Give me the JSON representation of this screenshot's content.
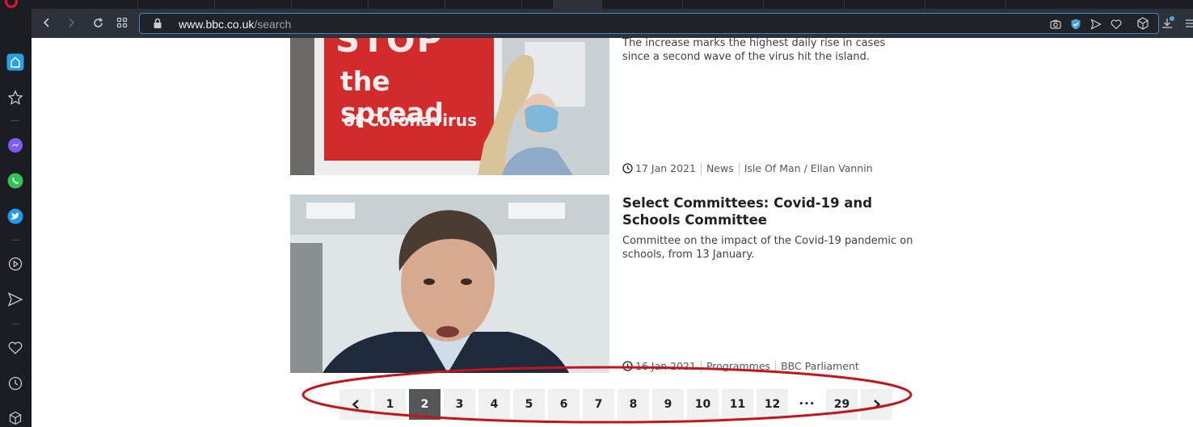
{
  "browser": {
    "url_host": "www.bbc.co.uk",
    "url_path": "/search"
  },
  "articles": [
    {
      "summary": "The increase marks the highest daily rise in cases since a second wave of the virus hit the island.",
      "image_text_1": "STOP",
      "image_text_2": "the spread",
      "image_text_3": "of Coronavirus",
      "date": "17 Jan 2021",
      "section": "News",
      "source": "Isle Of Man / Ellan Vannin"
    },
    {
      "title": "Select Committees: Covid-19 and Schools Committee",
      "summary": "Committee on the impact of the Covid-19 pandemic on schools, from 13 January.",
      "date": "16 Jan 2021",
      "section": "Programmes",
      "source": "BBC Parliament"
    }
  ],
  "pagination": {
    "prev": "<",
    "pages": [
      "1",
      "2",
      "3",
      "4",
      "5",
      "6",
      "7",
      "8",
      "9",
      "10",
      "11",
      "12"
    ],
    "current": "2",
    "ellipsis": "•••",
    "last": "29",
    "next": ">"
  },
  "colors": {
    "annotation_circle": "#c0161c",
    "current_page_bg": "#545658"
  }
}
